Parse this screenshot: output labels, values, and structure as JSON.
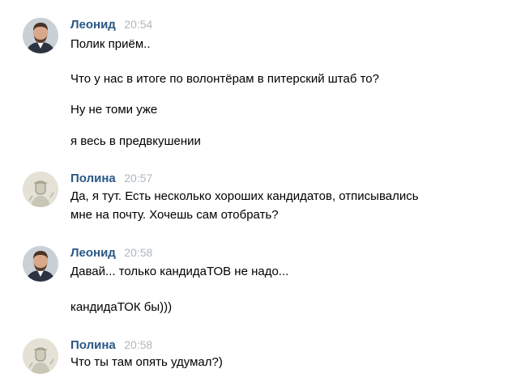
{
  "messages": [
    {
      "author": "Леонид",
      "time": "20:54",
      "avatar_icon": "man-portrait",
      "lines": [
        "Полик приём..",
        "Что у нас в итоге по волонтёрам в питерский штаб то?",
        "Ну не томи уже",
        "я весь в предвкушении"
      ]
    },
    {
      "author": "Полина",
      "time": "20:57",
      "avatar_icon": "sketch-portrait",
      "lines": [
        "Да, я тут. Есть несколько хороших кандидатов, отписывались",
        "мне на почту. Хочешь сам отобрать?"
      ]
    },
    {
      "author": "Леонид",
      "time": "20:58",
      "avatar_icon": "man-portrait",
      "lines": [
        "Давай... только кандидаТОВ не надо...",
        "кандидаТОК бы)))"
      ]
    },
    {
      "author": "Полина",
      "time": "20:58",
      "avatar_icon": "sketch-portrait",
      "lines": [
        "Что ты там опять удумал?)"
      ]
    }
  ],
  "colors": {
    "author": "#2a5885",
    "time": "#b0b7bf",
    "text": "#000000"
  }
}
